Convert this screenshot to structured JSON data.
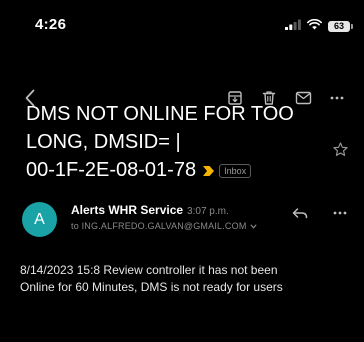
{
  "status_bar": {
    "time": "4:26",
    "battery": "63"
  },
  "toolbar": {
    "icons": [
      "back-icon",
      "archive-icon",
      "delete-icon",
      "mail-icon",
      "more-icon"
    ]
  },
  "email": {
    "subject_lines": [
      "DMS NOT ONLINE FOR TOO",
      "LONG, DMSID= |",
      "00-1F-2E-08-01-78"
    ],
    "label": "Inbox",
    "importance_color": "#f5b400",
    "sender": {
      "initial": "A",
      "name": "Alerts WHR Service",
      "time": "3:07 p.m.",
      "recipient": "to ING.ALFREDO.GALVAN@GMAIL.COM",
      "avatar_color": "#1aa3a6"
    },
    "body_lines": [
      "8/14/2023 15:8 Review controller it has not been",
      "Online for 60 Minutes, DMS is not ready for users"
    ]
  }
}
